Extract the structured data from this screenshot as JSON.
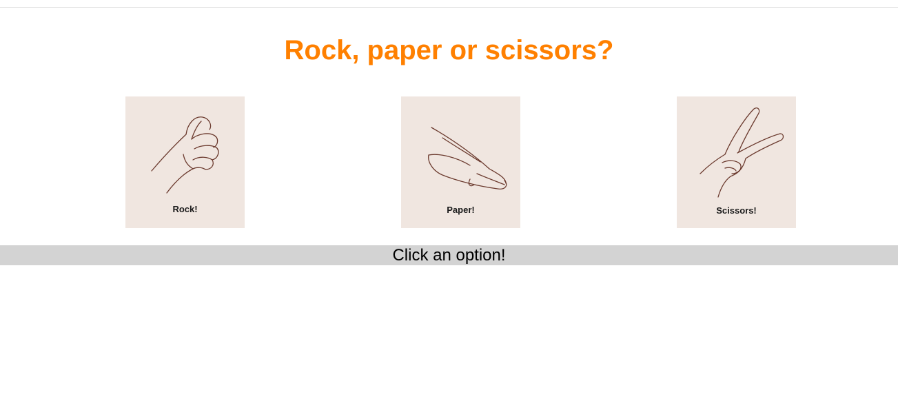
{
  "page": {
    "title": "Rock, paper or scissors?",
    "title_color": "#ff8000"
  },
  "choices": [
    {
      "id": "rock",
      "label": "Rock!",
      "icon": "fist-hand-icon"
    },
    {
      "id": "paper",
      "label": "Paper!",
      "icon": "flat-hand-icon"
    },
    {
      "id": "scissors",
      "label": "Scissors!",
      "icon": "v-sign-hand-icon"
    }
  ],
  "status": {
    "message": "Click an option!",
    "background": "#d3d3d3"
  },
  "colors": {
    "card_background": "#f0e6e0",
    "sketch_stroke": "#6b3a2e"
  }
}
